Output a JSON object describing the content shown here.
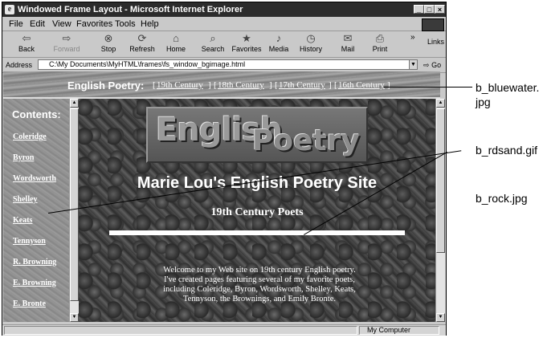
{
  "window": {
    "title": "Windowed Frame Layout - Microsoft Internet Explorer",
    "controls": {
      "minimize": "_",
      "maximize": "□",
      "close": "×"
    }
  },
  "menu": [
    "File",
    "Edit",
    "View",
    "Favorites",
    "Tools",
    "Help"
  ],
  "toolbar": {
    "buttons": [
      {
        "label": "Back",
        "icon": "back-arrow-icon",
        "glyph": "⇦"
      },
      {
        "label": "Forward",
        "icon": "forward-arrow-icon",
        "glyph": "⇨"
      },
      {
        "label": "Stop",
        "icon": "stop-icon",
        "glyph": "⊗"
      },
      {
        "label": "Refresh",
        "icon": "refresh-icon",
        "glyph": "⟳"
      },
      {
        "label": "Home",
        "icon": "home-icon",
        "glyph": "⌂"
      },
      {
        "label": "Search",
        "icon": "search-icon",
        "glyph": "⌕"
      },
      {
        "label": "Favorites",
        "icon": "favorites-icon",
        "glyph": "★"
      },
      {
        "label": "Media",
        "icon": "media-icon",
        "glyph": "♪"
      },
      {
        "label": "History",
        "icon": "history-icon",
        "glyph": "◷"
      },
      {
        "label": "Mail",
        "icon": "mail-icon",
        "glyph": "✉"
      },
      {
        "label": "Print",
        "icon": "print-icon",
        "glyph": "⎙"
      }
    ],
    "links_label": "Links",
    "overflow": "»"
  },
  "address": {
    "label": "Address",
    "value": "C:\\My Documents\\MyHTML\\frames\\fs_window_bgimage.html",
    "go_label": "Go"
  },
  "top_frame": {
    "heading": "English Poetry:",
    "links": [
      "19th Century",
      "18th Century",
      "17th Century",
      "16th Century"
    ]
  },
  "left_frame": {
    "heading": "Contents:",
    "items": [
      "Coleridge",
      "Byron",
      "Wordsworth",
      "Shelley",
      "Keats",
      "Tennyson",
      "R. Browning",
      "E. Browning",
      "E. Bronte"
    ]
  },
  "main_frame": {
    "logo_word1": "English",
    "logo_word2": "Poetry",
    "site_title": "Marie Lou's English Poetry Site",
    "subtitle": "19th Century Poets",
    "welcome_lines": [
      "Welcome to my Web site on 19th century English poetry.",
      "I've created pages featuring several of my favorite poets,",
      "including Coleridge, Byron, Wordsworth, Shelley, Keats,",
      "Tennyson, the Brownings, and Emily Bronte."
    ]
  },
  "status": {
    "zone": "My Computer"
  },
  "callouts": {
    "bluewater_line1": "b_bluewater.",
    "bluewater_line2": "jpg",
    "rdsand": "b_rdsand.gif",
    "rock": "b_rock.jpg"
  }
}
